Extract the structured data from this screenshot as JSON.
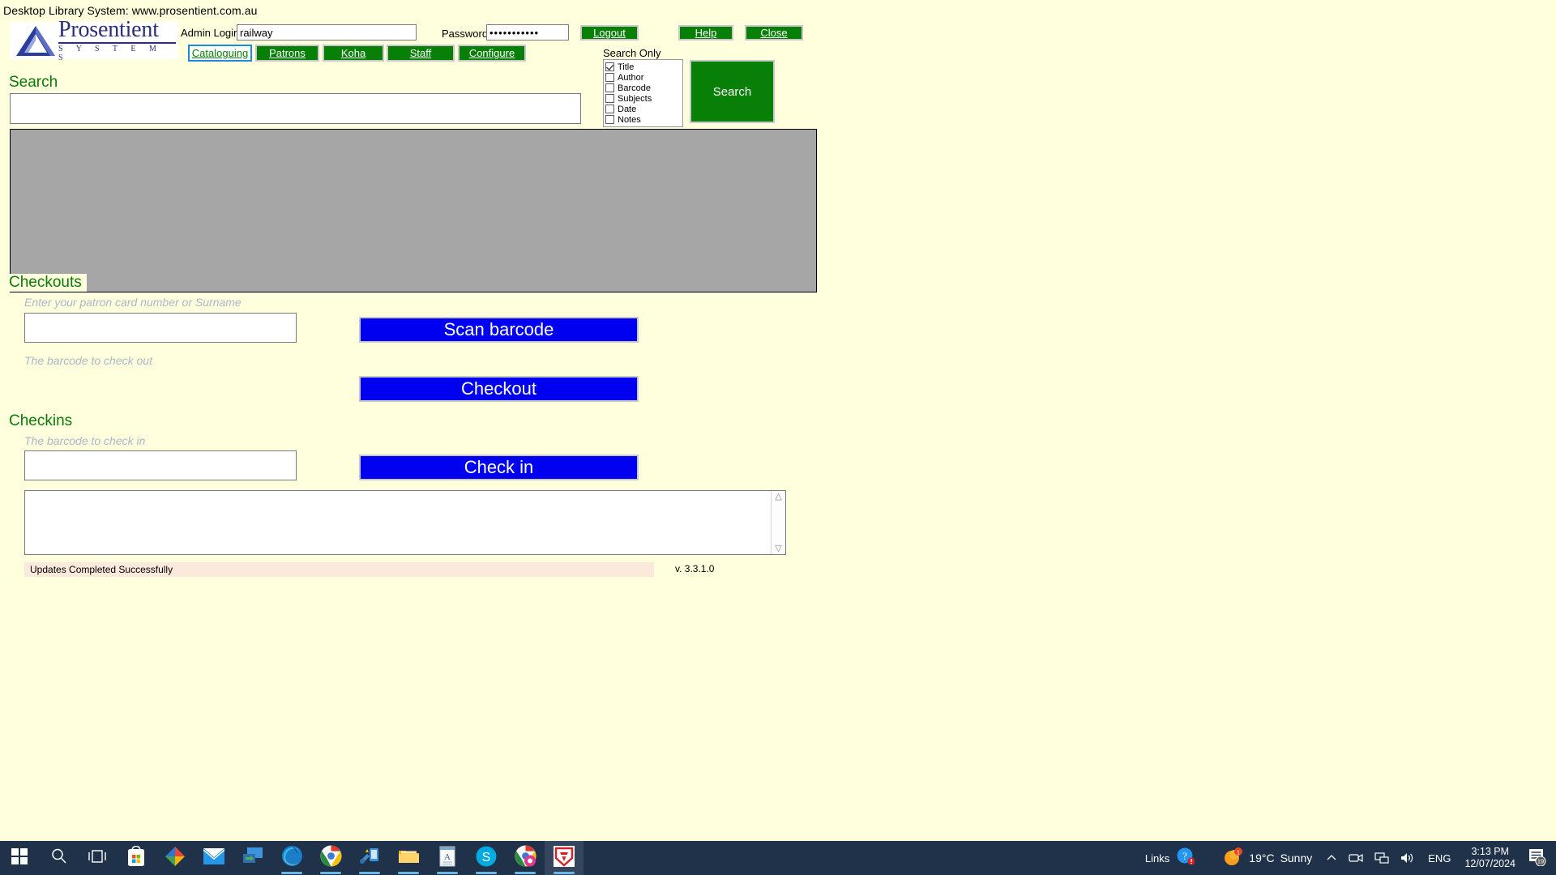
{
  "window": {
    "title": "Desktop Library System: www.prosentient.com.au"
  },
  "logo": {
    "word": "Prosentient",
    "subtitle": "S Y S T E M S",
    "mark": "triangle-logo-icon"
  },
  "auth": {
    "admin_login_label": "Admin Login",
    "admin_login_value": "railway",
    "password_label": "Password",
    "password_value": "•••••••••••",
    "logout_label": "Logout",
    "help_label": "Help",
    "close_label": "Close"
  },
  "nav": {
    "items": [
      {
        "label": "Cataloguing",
        "active": true
      },
      {
        "label": "Patrons",
        "active": false
      },
      {
        "label": "Koha",
        "active": false
      },
      {
        "label": "Staff",
        "active": false
      },
      {
        "label": "Configure",
        "active": false
      }
    ]
  },
  "search": {
    "heading": "Search",
    "input_value": "",
    "search_only_label": "Search Only",
    "options": [
      {
        "label": "Title",
        "checked": true
      },
      {
        "label": "Author",
        "checked": false
      },
      {
        "label": "Barcode",
        "checked": false
      },
      {
        "label": "Subjects",
        "checked": false
      },
      {
        "label": "Date",
        "checked": false
      },
      {
        "label": "Notes",
        "checked": false
      }
    ],
    "search_button_label": "Search"
  },
  "results": {
    "rows": []
  },
  "checkouts": {
    "heading": "Checkouts",
    "patron_hint": "Enter your patron card number or Surname",
    "patron_value": "",
    "barcode_hint": "The barcode to check out",
    "scan_button_label": "Scan barcode",
    "checkout_button_label": "Checkout"
  },
  "checkins": {
    "heading": "Checkins",
    "hint": "The barcode to check in",
    "barcode_value": "",
    "checkin_button_label": "Check in"
  },
  "log": {
    "content": "",
    "scroll_up_icon": "chevron-up-icon",
    "scroll_down_icon": "chevron-down-icon"
  },
  "status": {
    "message": "Updates Completed Successfully",
    "version": "v. 3.3.1.0"
  },
  "taskbar": {
    "items": [
      {
        "name": "start-button",
        "icon": "windows-logo-icon"
      },
      {
        "name": "search-button",
        "icon": "magnifier-icon"
      },
      {
        "name": "task-view-button",
        "icon": "task-view-icon"
      },
      {
        "name": "microsoft-store",
        "icon": "store-icon"
      },
      {
        "name": "app-colorful-diamond",
        "icon": "diamond-app-icon"
      },
      {
        "name": "mail-app",
        "icon": "mail-icon"
      },
      {
        "name": "remote-desktop-app",
        "icon": "remote-desktop-icon"
      },
      {
        "name": "microsoft-edge",
        "icon": "edge-icon"
      },
      {
        "name": "google-chrome",
        "icon": "chrome-icon"
      },
      {
        "name": "network-tool-app",
        "icon": "network-tool-icon"
      },
      {
        "name": "file-explorer",
        "icon": "folder-icon"
      },
      {
        "name": "reader-app",
        "icon": "document-reader-icon"
      },
      {
        "name": "skype",
        "icon": "skype-icon"
      },
      {
        "name": "chrome-profile",
        "icon": "chrome-profile-icon"
      },
      {
        "name": "prosentient-library-app",
        "icon": "red-shield-icon"
      }
    ],
    "links_label": "Links",
    "links_icon": "help-question-icon",
    "weather_temp": "19°C",
    "weather_desc": "Sunny",
    "weather_badge": "1",
    "tray": {
      "chevron_icon": "chevron-up-icon",
      "camera_icon": "camera-icon",
      "network_icon": "network-icon",
      "volume_icon": "speaker-icon",
      "language": "ENG"
    },
    "clock_time": "3:13 PM",
    "clock_date": "12/07/2024",
    "notification_badge": "19",
    "notification_icon": "action-center-icon"
  }
}
